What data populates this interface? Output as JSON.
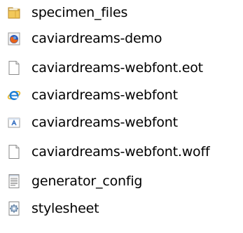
{
  "files": [
    {
      "name": "specimen_files",
      "icon": "folder-icon"
    },
    {
      "name": "caviardreams-demo",
      "icon": "firefox-html-icon"
    },
    {
      "name": "caviardreams-webfont.eot",
      "icon": "blank-file-icon"
    },
    {
      "name": "caviardreams-webfont",
      "icon": "internet-explorer-icon"
    },
    {
      "name": "caviardreams-webfont",
      "icon": "font-file-icon"
    },
    {
      "name": "caviardreams-webfont.woff",
      "icon": "blank-file-icon"
    },
    {
      "name": "generator_config",
      "icon": "text-file-icon"
    },
    {
      "name": "stylesheet",
      "icon": "css-file-icon"
    }
  ]
}
